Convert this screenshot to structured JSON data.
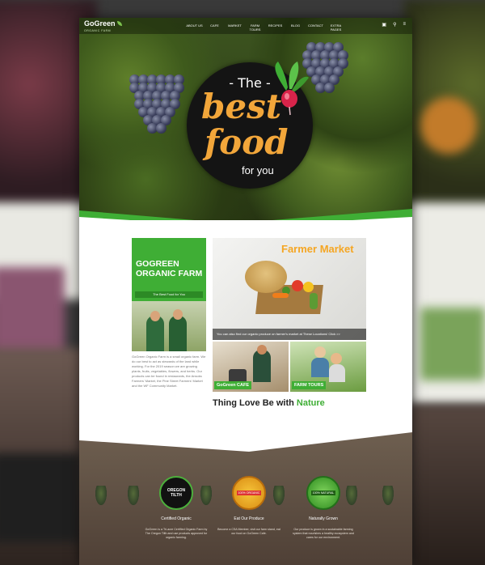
{
  "brand": {
    "name": "GoGreen",
    "tagline": "ORGANIC FARM"
  },
  "nav": {
    "items": [
      "ABOUT US",
      "CAFE",
      "MARKET",
      "FARM TOURS",
      "RECIPES",
      "BLOG",
      "CONTACT",
      "EXTRA PAGES"
    ]
  },
  "hero": {
    "the": "- The -",
    "best": "best",
    "food": "food",
    "for_you": "for you"
  },
  "intro": {
    "title": "GOGREEN ORGANIC FARM",
    "subtitle": "The Best Food for You",
    "description": "GoGreen Organic Farm is a small organic farm. We do our best to act as stewards of the land while working. For the 2019 season we are growing plants, fruits, vegetables, flowers, and herbs. Our products can be found in restaurants, the Ansoks Farmers' Market, the Pine Street Farmers' Market and the WF Community Market."
  },
  "market": {
    "title": "Farmer Market",
    "caption": "You can also find our organic produce on farmer's market at These Locations! Click >>"
  },
  "cafe_tag": "GoGreen CAFE",
  "tours_tag": "FARM TOURS",
  "slogan": {
    "prefix": "Thing Love Be with",
    "highlight": "Nature"
  },
  "features": [
    {
      "badge": "OREGON TILTH",
      "title": "Certified Organic",
      "text": "GoGreen is a Tri-acre Certified Organic Farm by The Oregon Tilth and use products approved for organic farming."
    },
    {
      "badge": "100% ORGANIC",
      "title": "Eat Our Produce",
      "text": "Become a CSA Member, visit our farm stand, eat our food on GoGreen Cafe."
    },
    {
      "badge": "100% NATURAL",
      "title": "Naturally Grown",
      "text": "Our produce is grown in a sustainable farming system that nourishes a healthy ecosystem and cares for our environment."
    }
  ],
  "colors": {
    "accent": "#3fae35",
    "orange": "#f2a63a",
    "dark": "#141414"
  }
}
